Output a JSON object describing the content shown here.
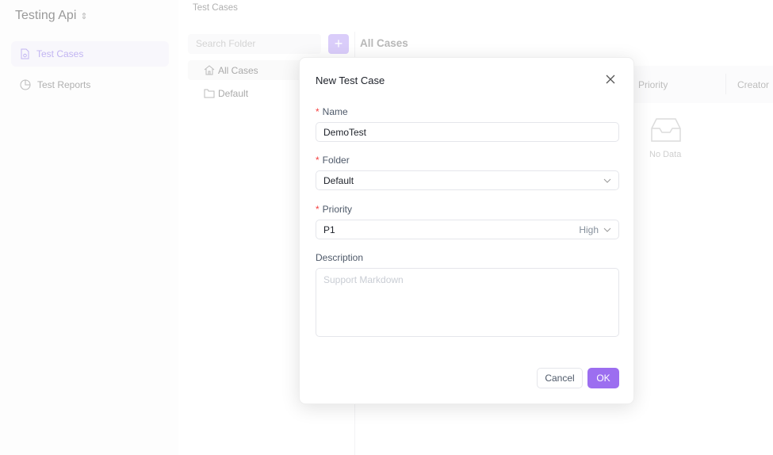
{
  "sidebar": {
    "app_title": "Testing Api",
    "items": [
      {
        "label": "Test Cases",
        "icon": "file-icon",
        "active": true
      },
      {
        "label": "Test Reports",
        "icon": "pie-chart-icon",
        "active": false
      }
    ]
  },
  "breadcrumb": "Test Cases",
  "folders": {
    "search_placeholder": "Search Folder",
    "items": [
      {
        "label": "All Cases",
        "icon": "home-icon"
      },
      {
        "label": "Default",
        "icon": "folder-icon"
      }
    ]
  },
  "main": {
    "title": "All Cases",
    "columns": [
      "Priority",
      "Creator"
    ],
    "empty_text": "No Data"
  },
  "modal": {
    "title": "New Test Case",
    "name": {
      "label": "Name",
      "value": "DemoTest"
    },
    "folder": {
      "label": "Folder",
      "value": "Default"
    },
    "priority": {
      "label": "Priority",
      "value": "P1",
      "level": "High"
    },
    "description": {
      "label": "Description",
      "placeholder": "Support Markdown"
    },
    "cancel": "Cancel",
    "ok": "OK"
  },
  "colors": {
    "accent": "#9c6ef0",
    "required": "#f53f3f"
  }
}
